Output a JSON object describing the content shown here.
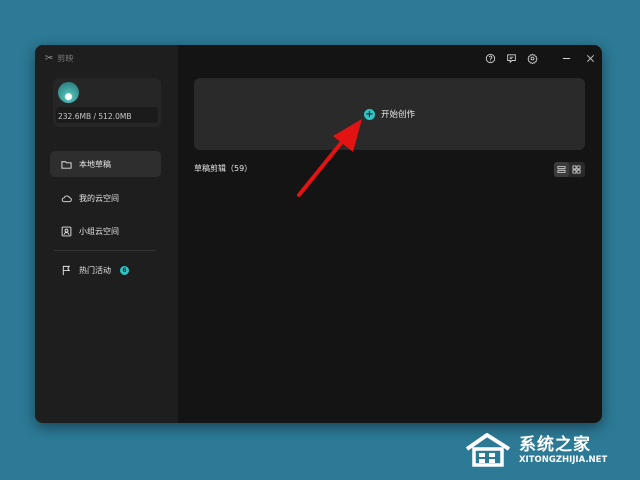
{
  "app": {
    "logo_mark": "✂",
    "name": "剪映"
  },
  "user": {
    "storage_text": "232.6MB / 512.0MB"
  },
  "sidebar": {
    "items": [
      {
        "label": "本地草稿",
        "icon": "folder-icon",
        "active": true
      },
      {
        "label": "我的云空间",
        "icon": "cloud-icon",
        "active": false
      },
      {
        "label": "小组云空间",
        "icon": "group-icon",
        "active": false
      },
      {
        "label": "热门活动",
        "icon": "flag-icon",
        "active": false,
        "badge": "6"
      }
    ]
  },
  "toolbar": {
    "icons": [
      "help-icon",
      "feedback-icon",
      "settings-icon",
      "minimize-icon",
      "close-icon"
    ]
  },
  "main": {
    "create_label": "开始创作",
    "drafts_title": "草稿剪辑（59）"
  },
  "colors": {
    "accent": "#2fc4c6",
    "arrow": "#e41313",
    "background": "#2c7a96"
  },
  "watermark": {
    "title": "系统之家",
    "url": "XITONGZHIJIA.NET"
  }
}
